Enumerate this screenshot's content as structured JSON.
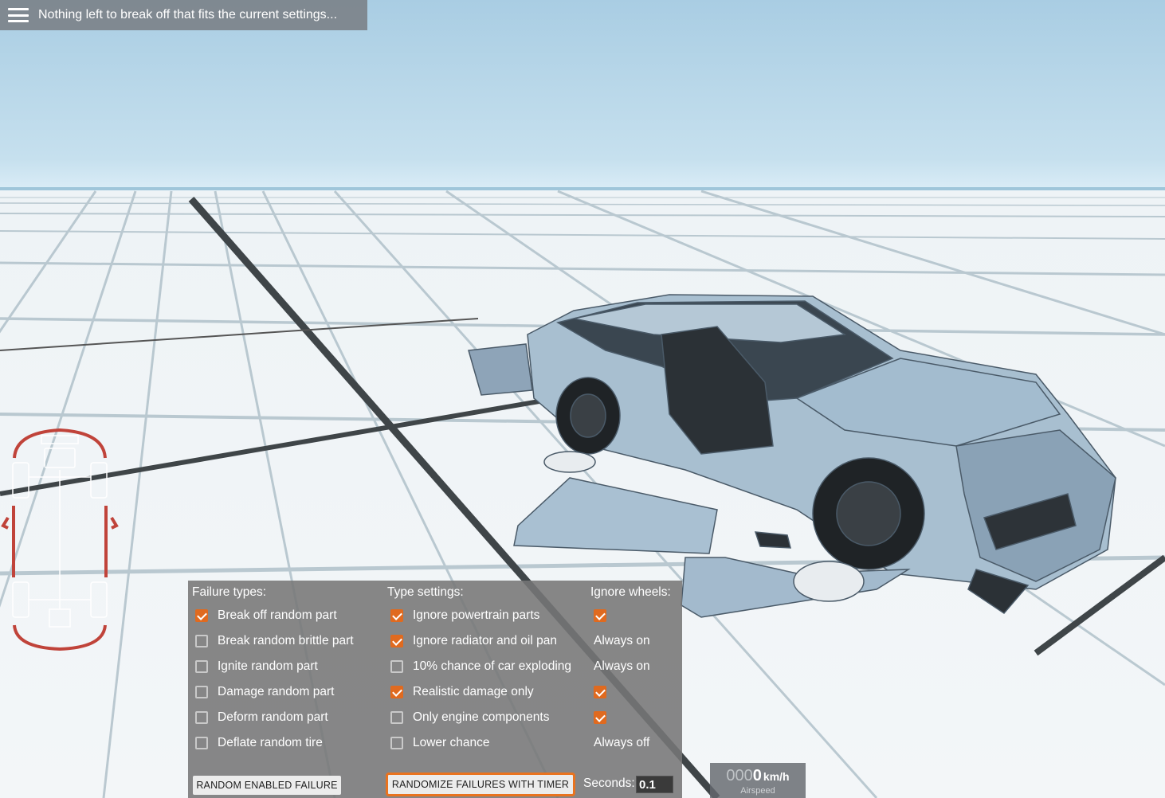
{
  "topbar": {
    "menu_icon": "hamburger-menu-icon",
    "message": "Nothing left to break off that fits the current settings..."
  },
  "colors": {
    "accent": "#e06a1f",
    "panel_bg": "#767676",
    "damage_red": "#c0433a"
  },
  "panel": {
    "failure_types": {
      "title": "Failure types:",
      "items": [
        {
          "label": "Break off random part",
          "checked": true
        },
        {
          "label": "Break random brittle part",
          "checked": false
        },
        {
          "label": "Ignite random part",
          "checked": false
        },
        {
          "label": "Damage random part",
          "checked": false
        },
        {
          "label": "Deform random part",
          "checked": false
        },
        {
          "label": "Deflate random tire",
          "checked": false
        }
      ]
    },
    "type_settings": {
      "title": "Type settings:",
      "items": [
        {
          "label": "Ignore powertrain parts",
          "checked": true
        },
        {
          "label": "Ignore radiator and oil pan",
          "checked": true
        },
        {
          "label": "10% chance of car exploding",
          "checked": false
        },
        {
          "label": "Realistic damage only",
          "checked": true
        },
        {
          "label": "Only engine components",
          "checked": false
        },
        {
          "label": "Lower chance",
          "checked": false
        }
      ]
    },
    "ignore_wheels": {
      "title": "Ignore wheels:",
      "items": [
        {
          "type": "checkbox",
          "checked": true,
          "text": ""
        },
        {
          "type": "text",
          "text": "Always on"
        },
        {
          "type": "text",
          "text": "Always on"
        },
        {
          "type": "checkbox",
          "checked": true,
          "text": ""
        },
        {
          "type": "checkbox",
          "checked": true,
          "text": ""
        },
        {
          "type": "text",
          "text": "Always off"
        }
      ]
    },
    "random_failure_button": "RANDOM ENABLED FAILURE",
    "timer_button": "RANDOMIZE FAILURES WITH TIMER",
    "seconds_label": "Seconds:",
    "seconds_value": "0.1"
  },
  "speedometer": {
    "leading_digits": "000",
    "value": "0",
    "unit": "km/h",
    "caption": "Airspeed"
  }
}
